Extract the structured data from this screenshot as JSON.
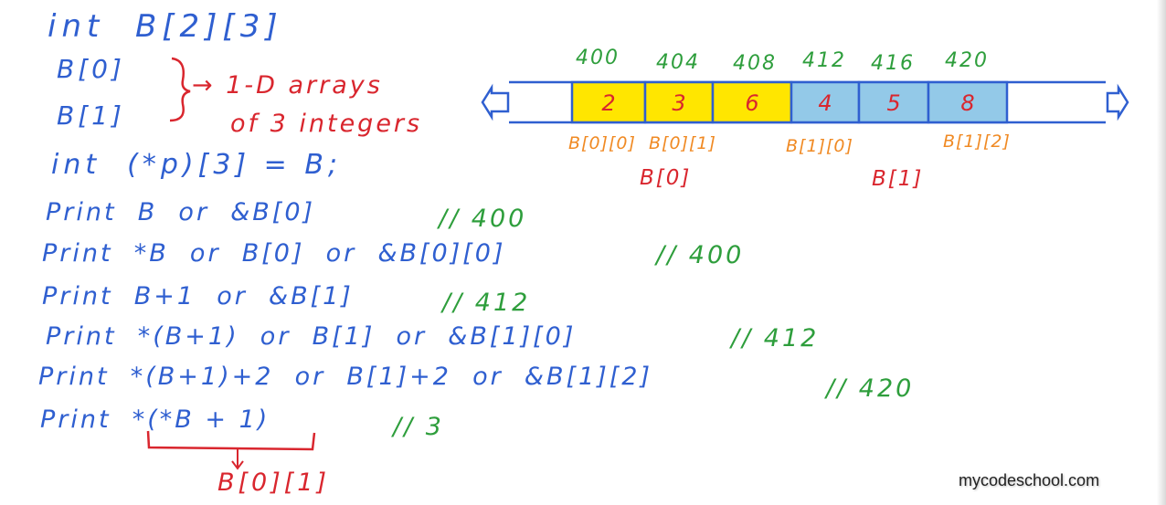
{
  "colors": {
    "blue": "#2f5fd0",
    "green": "#2e9e3c",
    "red": "#d9262e",
    "orange": "#f08a24",
    "yellow_cell": "#ffe600",
    "blue_cell": "#93c9e8"
  },
  "declaration": "int  B[2][3]",
  "subarrays": {
    "b0": "B[0]",
    "b1": "B[1]",
    "brace_note_line1": "→ 1-D arrays",
    "brace_note_line2": "of 3 integers"
  },
  "pointer_decl": "int  (*p)[3] = B;",
  "statements": [
    {
      "code": "Print  B  or  &B[0]",
      "comment": "// 400"
    },
    {
      "code": "Print  *B  or  B[0]  or  &B[0][0]",
      "comment": "// 400"
    },
    {
      "code": "Print  B+1  or  &B[1]",
      "comment": "// 412"
    },
    {
      "code": "Print  *(B+1)  or  B[1]  or  &B[1][0]",
      "comment": "// 412"
    },
    {
      "code": "Print  *(B+1)+2  or  B[1]+2  or  &B[1][2]",
      "comment": "// 420"
    },
    {
      "code": "Print  *(*B + 1)",
      "comment": "// 3"
    }
  ],
  "brace_result": "B[0][1]",
  "memory": {
    "addresses": [
      "400",
      "404",
      "408",
      "412",
      "416",
      "420"
    ],
    "cells": [
      {
        "value": "2",
        "group": "B[0]"
      },
      {
        "value": "3",
        "group": "B[0]"
      },
      {
        "value": "6",
        "group": "B[0]"
      },
      {
        "value": "4",
        "group": "B[1]"
      },
      {
        "value": "5",
        "group": "B[1]"
      },
      {
        "value": "8",
        "group": "B[1]"
      }
    ],
    "element_labels": [
      "B[0][0]",
      "B[0][1]",
      "B[1][0]",
      "B[1][2]"
    ],
    "group_labels": [
      "B[0]",
      "B[1]"
    ]
  },
  "watermark": "mycodeschool.com"
}
